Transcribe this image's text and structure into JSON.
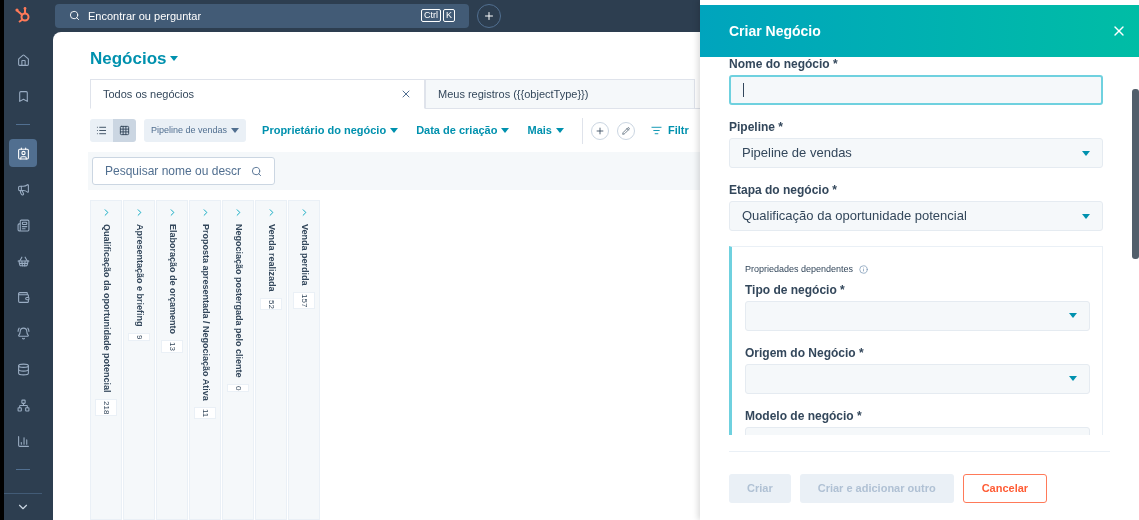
{
  "top_bar": {
    "search_placeholder": "Encontrar ou perguntar",
    "shortcut_keys": [
      "Ctrl",
      "K"
    ]
  },
  "nav_items": [
    {
      "kind": "home",
      "selected": false
    },
    {
      "kind": "bookmark",
      "selected": false
    },
    {
      "kind": "divider"
    },
    {
      "kind": "contacts",
      "selected": true
    },
    {
      "kind": "megaphone",
      "selected": false
    },
    {
      "kind": "newspaper",
      "selected": false
    },
    {
      "kind": "basket",
      "selected": false
    },
    {
      "kind": "wallet",
      "selected": false
    },
    {
      "kind": "bell",
      "selected": false
    },
    {
      "kind": "database",
      "selected": false
    },
    {
      "kind": "network",
      "selected": false
    },
    {
      "kind": "chart",
      "selected": false
    },
    {
      "kind": "divider"
    }
  ],
  "page": {
    "title": "Negócios",
    "tabs": [
      {
        "label": "Todos os negócios",
        "selected": true,
        "closable": true
      },
      {
        "label": "Meus registros ({{objectType}})",
        "selected": false,
        "closable": false
      }
    ],
    "view_modes": [
      {
        "kind": "list",
        "selected": false
      },
      {
        "kind": "board",
        "selected": true
      }
    ],
    "pipeline": "Pipeline de vendas",
    "filters": [
      "Proprietário do negócio",
      "Data de criação",
      "Mais"
    ],
    "filter_button": "Filtr",
    "search_placeholder": "Pesquisar nome ou descr",
    "stages": [
      {
        "name": "Qualificação da oportunidade potencial",
        "count": "218"
      },
      {
        "name": "Apresentação e briefing",
        "count": "9"
      },
      {
        "name": "Elaboração de orçamento",
        "count": "13"
      },
      {
        "name": "Proposta apresentada / Negociação Ativa",
        "count": "11"
      },
      {
        "name": "Negociação postergada pelo cliente",
        "count": "0"
      },
      {
        "name": "Venda realizada",
        "count": "52"
      },
      {
        "name": "Venda perdida",
        "count": "157"
      }
    ]
  },
  "panel": {
    "title": "Criar Negócio",
    "fields": [
      {
        "label": "Nome do negócio *",
        "kind": "text",
        "focused": true
      },
      {
        "label": "Pipeline *",
        "kind": "select",
        "value": "Pipeline de vendas"
      },
      {
        "label": "Etapa do negócio *",
        "kind": "select",
        "value": "Qualificação da oportunidade potencial"
      }
    ],
    "dependent": {
      "title": "Propriedades dependentes",
      "fields": [
        {
          "label": "Tipo de negócio *",
          "kind": "select"
        },
        {
          "label": "Origem do Negócio *",
          "kind": "select"
        },
        {
          "label": "Modelo de negócio *",
          "kind": "select"
        }
      ]
    },
    "buttons": [
      {
        "label": "Criar",
        "kind": "secondary",
        "disabled": true
      },
      {
        "label": "Criar e adicionar outro",
        "kind": "secondary",
        "disabled": true
      },
      {
        "label": "Cancelar",
        "kind": "cancel",
        "disabled": false
      }
    ]
  }
}
